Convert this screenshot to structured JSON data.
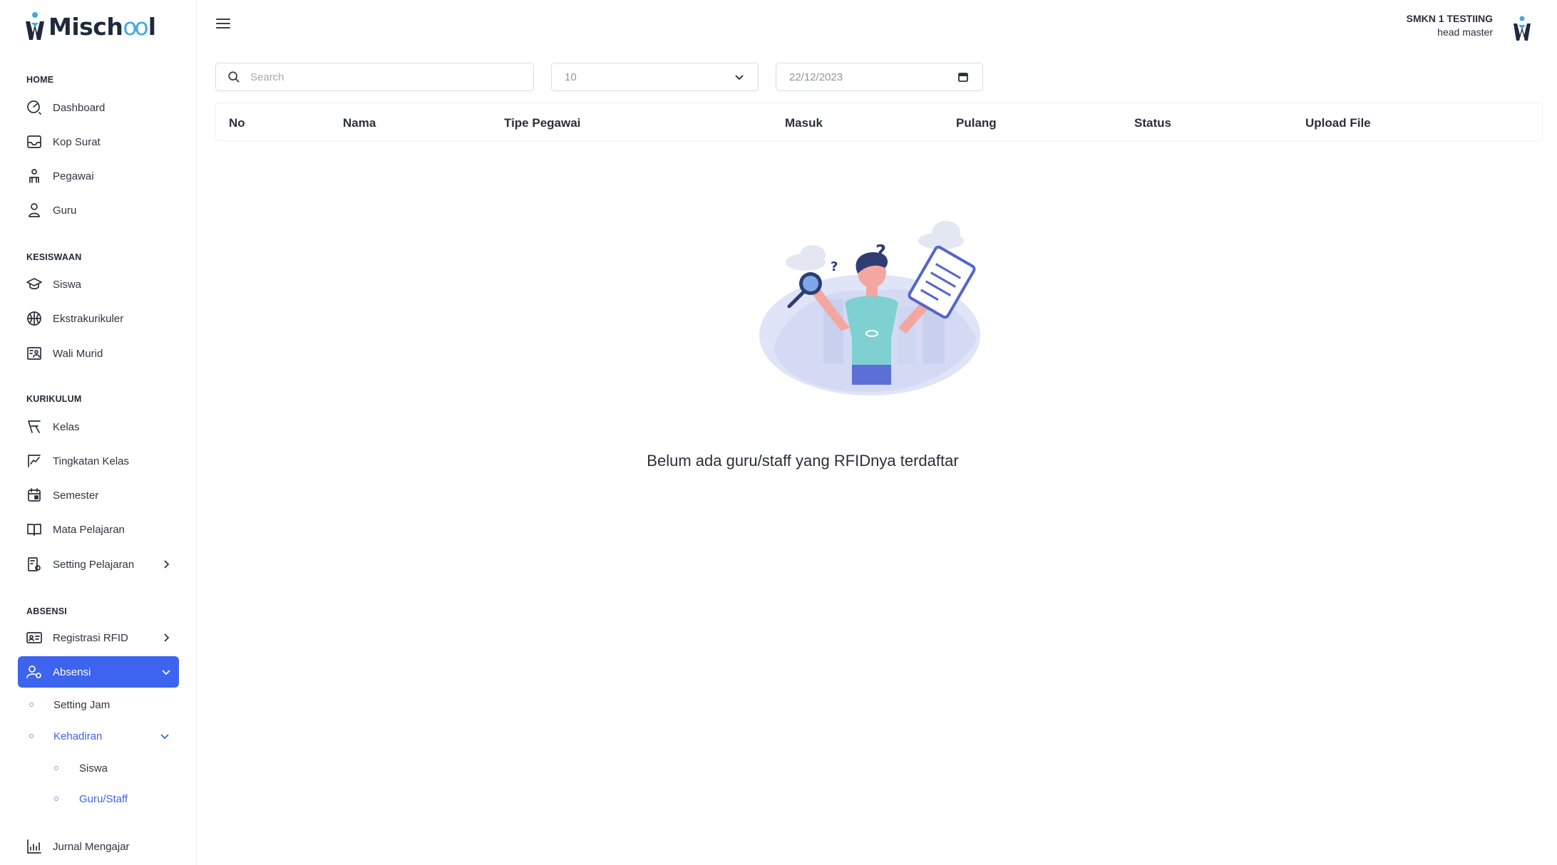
{
  "app": {
    "logo_text_1": "Misch",
    "logo_text_oo": "oo",
    "logo_text_2": "l"
  },
  "header": {
    "school": "SMKN 1 TESTIING",
    "role": "head master"
  },
  "sidebar": {
    "sections": {
      "home": "HOME",
      "kesiswaan": "KESISWAAN",
      "kurikulum": "KURIKULUM",
      "absensi": "ABSENSI"
    },
    "items": {
      "dashboard": "Dashboard",
      "kop_surat": "Kop Surat",
      "pegawai": "Pegawai",
      "guru": "Guru",
      "siswa": "Siswa",
      "ekstrakurikuler": "Ekstrakurikuler",
      "wali_murid": "Wali Murid",
      "kelas": "Kelas",
      "tingkatan_kelas": "Tingkatan Kelas",
      "semester": "Semester",
      "mata_pelajaran": "Mata Pelajaran",
      "setting_pelajaran": "Setting Pelajaran",
      "registrasi_rfid": "Registrasi RFID",
      "absensi": "Absensi",
      "setting_jam": "Setting Jam",
      "kehadiran": "Kehadiran",
      "kehadiran_siswa": "Siswa",
      "kehadiran_guru_staff": "Guru/Staff",
      "jurnal_mengajar": "Jurnal Mengajar"
    },
    "active_item": "Absensi",
    "accent_color": "#3c64ee"
  },
  "filters": {
    "search_placeholder": "Search",
    "page_size": "10",
    "date": "22/12/2023"
  },
  "table": {
    "columns": [
      "No",
      "Nama",
      "Tipe Pegawai",
      "Masuk",
      "Pulang",
      "Status",
      "Upload File"
    ],
    "rows": []
  },
  "empty_state": {
    "message": "Belum ada guru/staff yang RFIDnya terdaftar"
  }
}
